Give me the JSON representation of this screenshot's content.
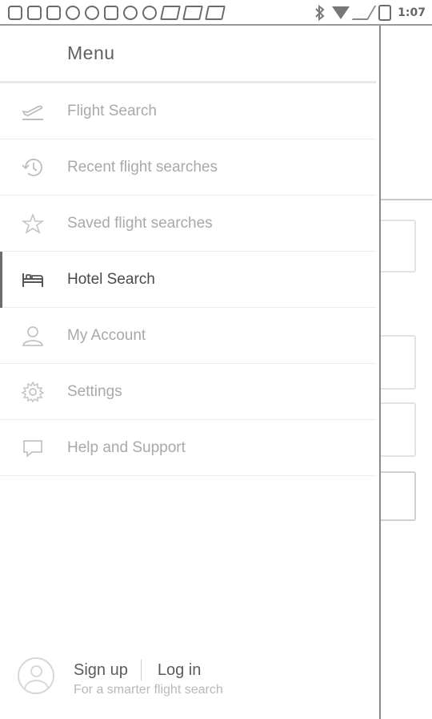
{
  "status_bar": {
    "time": "1:07",
    "notification_icons": [
      "more-icon",
      "facebook-icon",
      "facebook-icon",
      "recycle-icon",
      "leaf-icon",
      "5t-icon",
      "tools-icon",
      "wrench-icon",
      "skype-icon",
      "skype-icon",
      "skype-icon"
    ],
    "system_icons": [
      "bluetooth-icon",
      "wifi-icon",
      "signal-icon",
      "battery-icon"
    ]
  },
  "drawer": {
    "title": "Menu",
    "items": [
      {
        "label": "Flight Search",
        "icon": "plane-takeoff-icon",
        "active": false
      },
      {
        "label": "Recent flight searches",
        "icon": "history-icon",
        "active": false
      },
      {
        "label": "Saved flight searches",
        "icon": "star-icon",
        "active": false
      },
      {
        "label": "Hotel Search",
        "icon": "bed-icon",
        "active": true
      },
      {
        "label": "My Account",
        "icon": "person-icon",
        "active": false
      },
      {
        "label": "Settings",
        "icon": "gear-icon",
        "active": false
      },
      {
        "label": "Help and Support",
        "icon": "chat-icon",
        "active": false
      }
    ],
    "footer": {
      "sign_up": "Sign up",
      "log_in": "Log in",
      "tagline": "For a smarter flight search"
    }
  },
  "colors": {
    "active_text": "#4a4a4a",
    "inactive_text": "#a9a9a9",
    "divider": "#ececec",
    "accent_bar": "#6d6d6d"
  }
}
